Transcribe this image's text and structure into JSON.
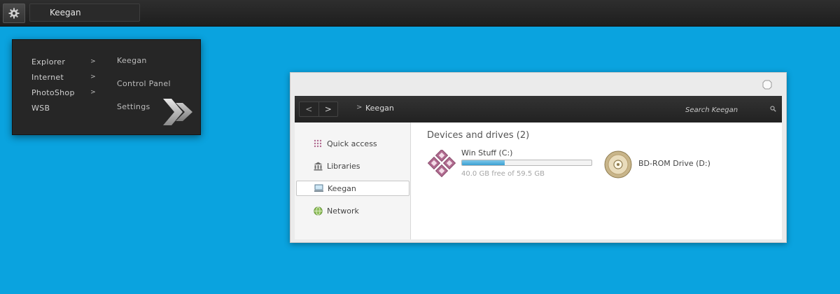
{
  "taskbar": {
    "window_button_label": "Keegan"
  },
  "start_menu": {
    "left_items": [
      {
        "label": "Explorer",
        "arrow": ">"
      },
      {
        "label": "Internet",
        "arrow": ">"
      },
      {
        "label": "PhotoShop",
        "arrow": ">"
      },
      {
        "label": "WSB",
        "arrow": ""
      }
    ],
    "right_items": [
      {
        "label": "Keegan"
      },
      {
        "label": "Control Panel"
      },
      {
        "label": "Settings"
      }
    ]
  },
  "explorer": {
    "nav": {
      "back_glyph": "<",
      "forward_glyph": ">",
      "breadcrumb_separator": ">",
      "breadcrumb": "Keegan",
      "search_placeholder": "Search Keegan"
    },
    "sidebar": [
      {
        "label": "Quick access",
        "icon": "quick-access-icon",
        "selected": false
      },
      {
        "label": "Libraries",
        "icon": "libraries-icon",
        "selected": false
      },
      {
        "label": "Keegan",
        "icon": "computer-icon",
        "selected": true
      },
      {
        "label": "Network",
        "icon": "network-icon",
        "selected": false
      }
    ],
    "section_title": "Devices and drives (2)",
    "drives": [
      {
        "name": "Win Stuff (C:)",
        "free_text": "40.0 GB free of 59.5 GB",
        "used_fraction": 0.33,
        "icon": "windows-drive-icon"
      },
      {
        "name": "BD-ROM Drive (D:)",
        "icon": "disc-drive-icon"
      }
    ]
  },
  "colors": {
    "desktop": "#0aa3df",
    "taskbar": "#262626",
    "menu_bg": "#262626",
    "progress_fill": "#3a9fd2",
    "drive_c_accent": "#b06a8f",
    "disc_accent": "#b8a070"
  }
}
